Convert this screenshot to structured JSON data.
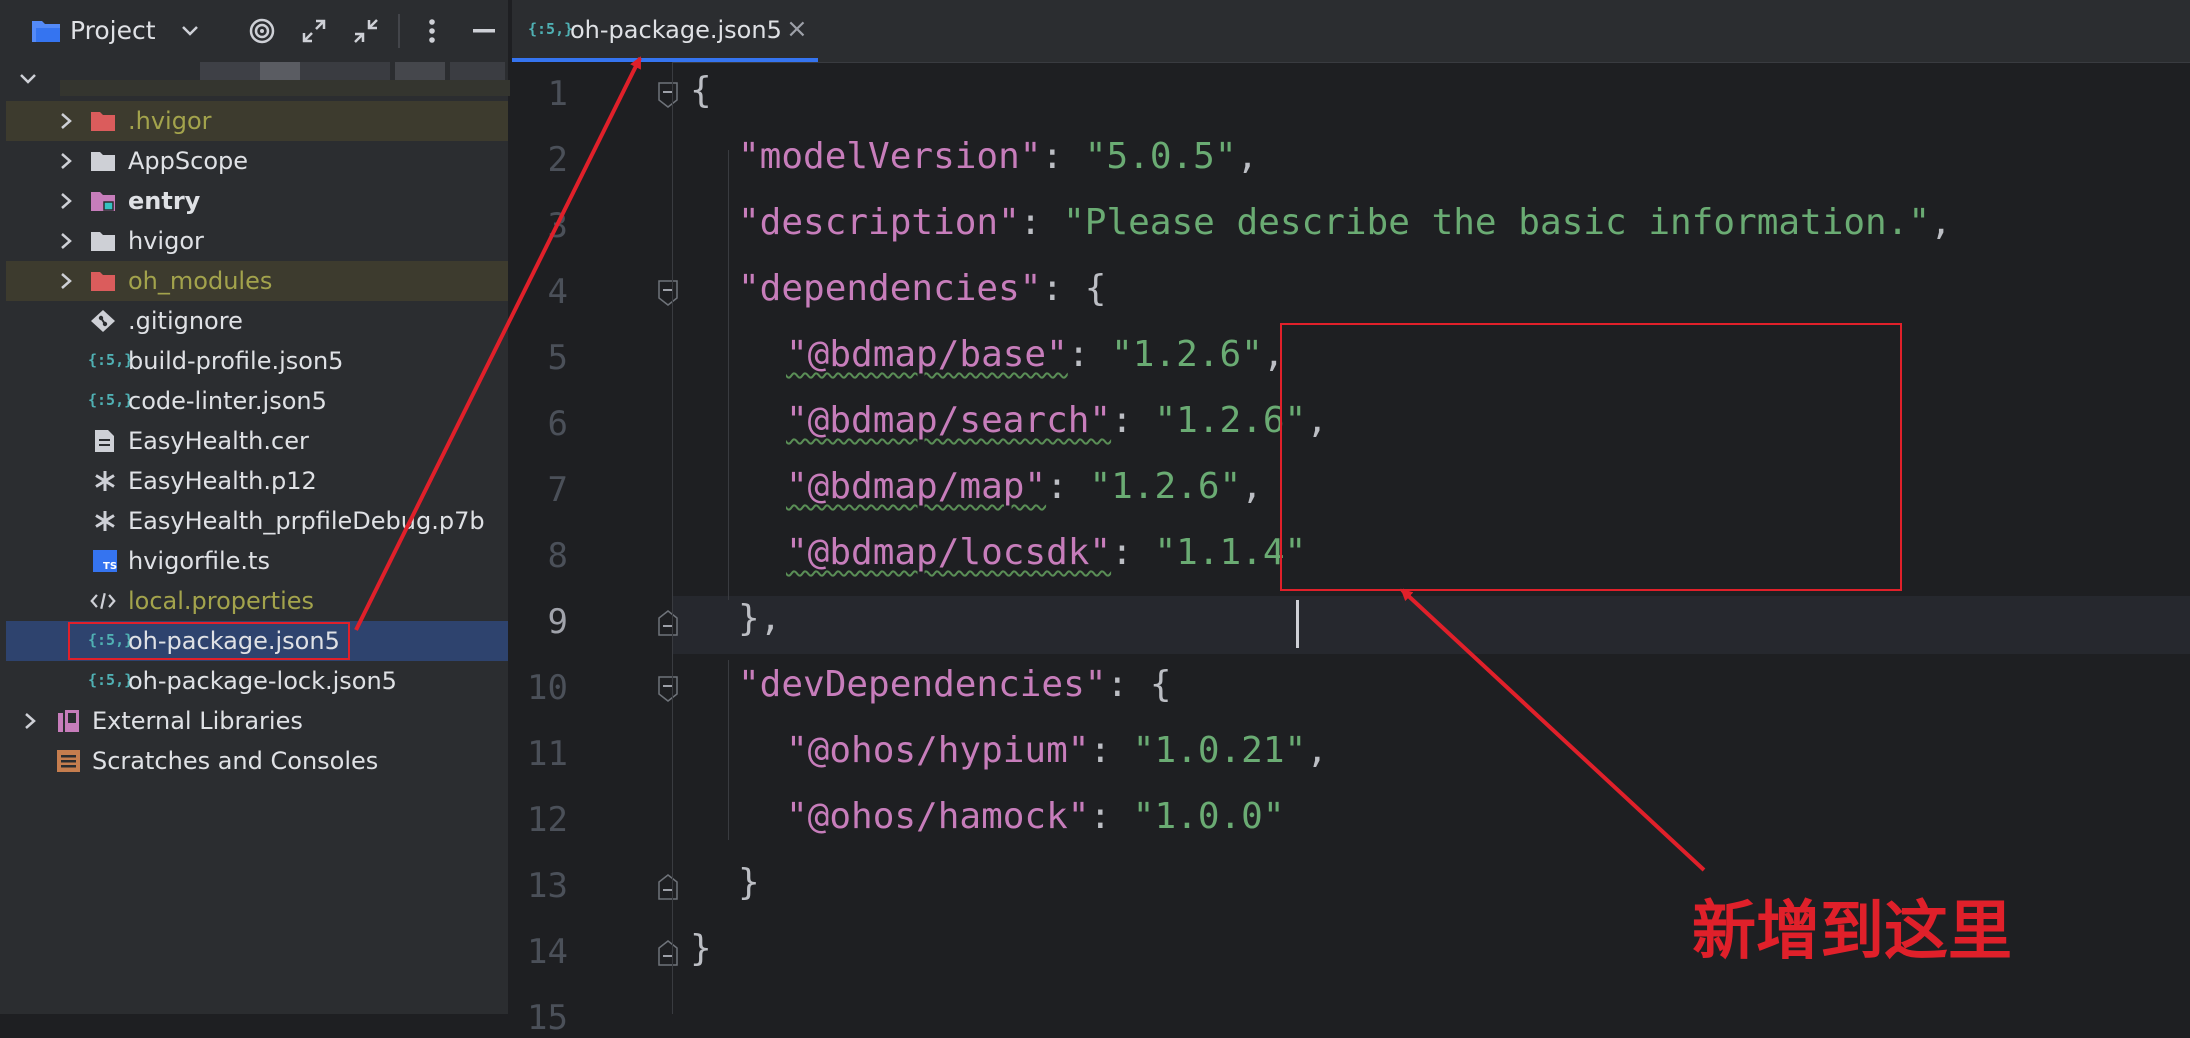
{
  "project_panel": {
    "title": "Project",
    "toolbar_icons": [
      "chevron-down-icon",
      "target-icon",
      "expand-all-icon",
      "collapse-all-icon",
      "more-icon",
      "minimize-icon"
    ],
    "tree": [
      {
        "label": ".hvigor",
        "type": "folder",
        "expandable": true,
        "style": "ignored"
      },
      {
        "label": "AppScope",
        "type": "folder",
        "expandable": true,
        "style": "normal"
      },
      {
        "label": "entry",
        "type": "module-folder",
        "expandable": true,
        "style": "bold"
      },
      {
        "label": "hvigor",
        "type": "folder",
        "expandable": true,
        "style": "normal"
      },
      {
        "label": "oh_modules",
        "type": "folder",
        "expandable": true,
        "style": "ignored"
      },
      {
        "label": ".gitignore",
        "type": "git-file"
      },
      {
        "label": "build-profile.json5",
        "type": "json5-file"
      },
      {
        "label": "code-linter.json5",
        "type": "json5-file"
      },
      {
        "label": "EasyHealth.cer",
        "type": "text-file"
      },
      {
        "label": "EasyHealth.p12",
        "type": "asterisk-file"
      },
      {
        "label": "EasyHealth_prpfileDebug.p7b",
        "type": "asterisk-file"
      },
      {
        "label": "hvigorfile.ts",
        "type": "ts-file"
      },
      {
        "label": "local.properties",
        "type": "properties-file",
        "style": "ignored"
      },
      {
        "label": "oh-package.json5",
        "type": "json5-file",
        "selected": true
      },
      {
        "label": "oh-package-lock.json5",
        "type": "json5-file"
      },
      {
        "label": "External Libraries",
        "type": "libraries"
      },
      {
        "label": "Scratches and Consoles",
        "type": "scratches"
      }
    ],
    "json5_badge": "{:5,}"
  },
  "editor": {
    "tab_title": "oh-package.json5",
    "tab_close": "×",
    "current_line": 9,
    "line_numbers": [
      "1",
      "2",
      "3",
      "4",
      "5",
      "6",
      "7",
      "8",
      "9",
      "10",
      "11",
      "12",
      "13",
      "14",
      "15"
    ],
    "code": {
      "l1_brace": "{",
      "l2_key": "\"modelVersion\"",
      "l2_val": "\"5.0.5\"",
      "l3_key": "\"description\"",
      "l3_val": "\"Please describe the basic information.\"",
      "l4_key": "\"dependencies\"",
      "l5_key": "\"@bdmap/base\"",
      "l5_val": "\"1.2.6\"",
      "l6_key": "\"@bdmap/search\"",
      "l6_val": "\"1.2.6\"",
      "l7_key": "\"@bdmap/map\"",
      "l7_val": "\"1.2.6\"",
      "l8_key": "\"@bdmap/locsdk\"",
      "l8_val": "\"1.1.4\"",
      "l9_close": "},",
      "l10_key": "\"devDependencies\"",
      "l11_key": "\"@ohos/hypium\"",
      "l11_val": "\"1.0.21\"",
      "l12_key": "\"@ohos/hamock\"",
      "l12_val": "\"1.0.0\"",
      "l13_close": "}",
      "l14_close": "}"
    }
  },
  "annotation": {
    "text": "新增到这里",
    "color": "#e0202a"
  }
}
